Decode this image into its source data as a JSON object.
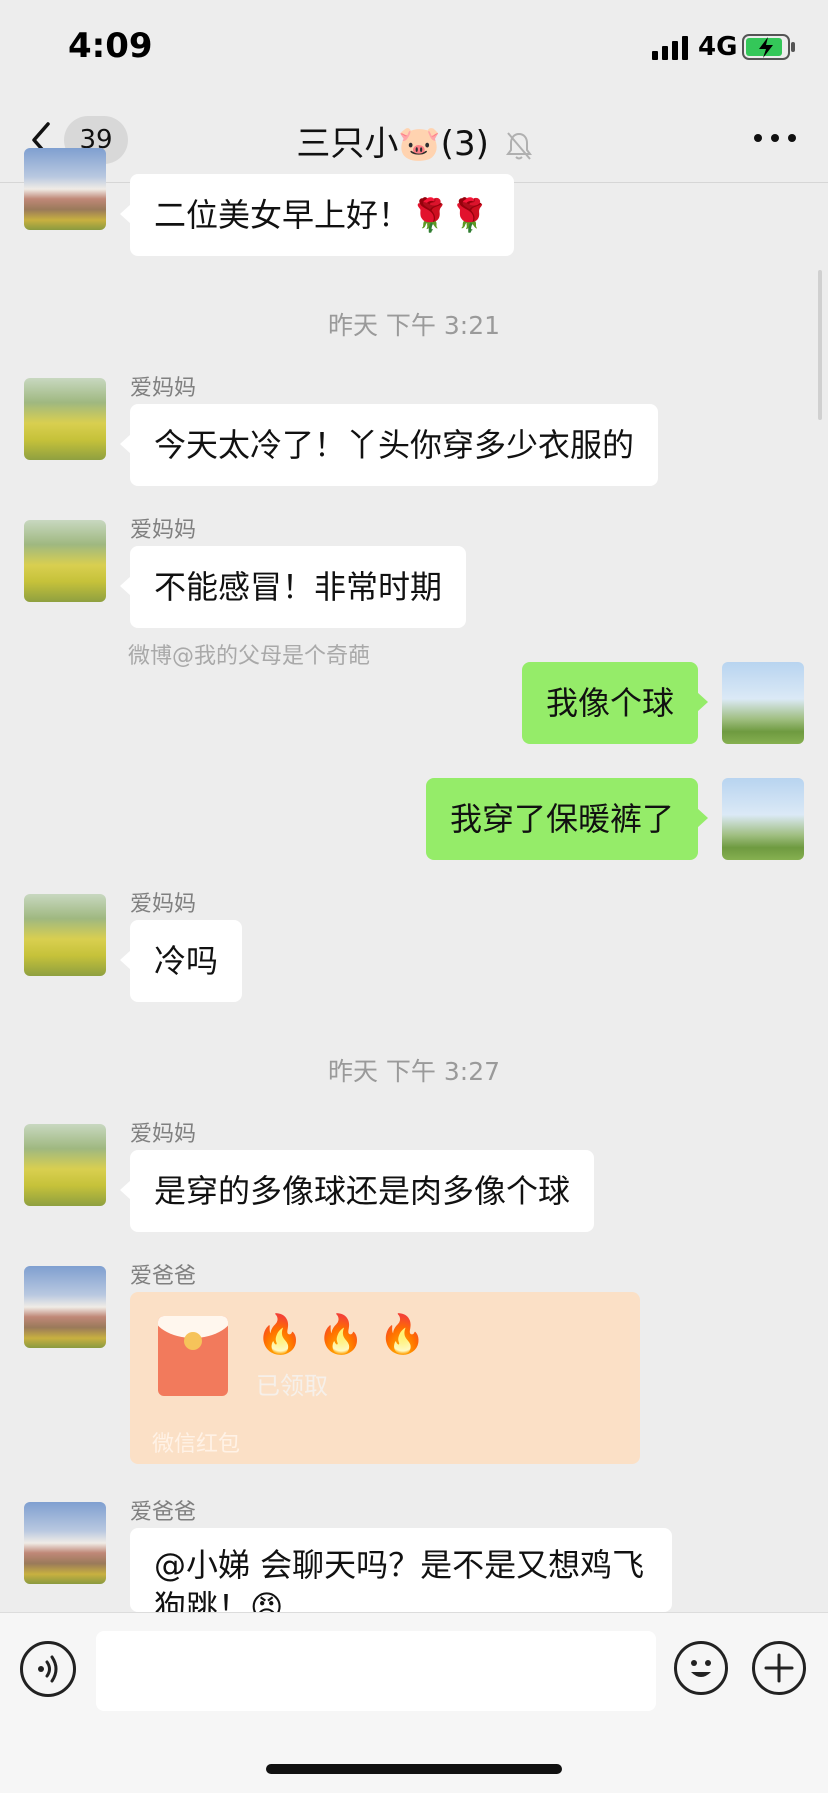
{
  "status_bar": {
    "time": "4:09",
    "network": "4G"
  },
  "nav": {
    "unread_count": "39",
    "title": "三只小🐷(3)"
  },
  "messages": [
    {
      "text": "二位美女早上好！🌹🌹"
    },
    {
      "timestamp": "昨天 下午 3:21"
    },
    {
      "sender": "爱妈妈",
      "text": "今天太冷了！丫头你穿多少衣服的"
    },
    {
      "sender": "爱妈妈",
      "text": "不能感冒！非常时期"
    },
    {
      "watermark": "微博@我的父母是个奇葩"
    },
    {
      "text": "我像个球"
    },
    {
      "text": "我穿了保暖裤了"
    },
    {
      "sender": "爱妈妈",
      "text": "冷吗"
    },
    {
      "timestamp": "昨天 下午 3:27"
    },
    {
      "sender": "爱妈妈",
      "text": "是穿的多像球还是肉多像个球"
    },
    {
      "sender": "爱爸爸",
      "red_packet": {
        "title": "🔥🔥🔥",
        "status": "已领取",
        "label": "微信红包"
      }
    },
    {
      "sender": "爱爸爸",
      "text": "@小娣 会聊天吗？是不是又想鸡飞狗跳！😡"
    }
  ],
  "input": {
    "placeholder": ""
  }
}
